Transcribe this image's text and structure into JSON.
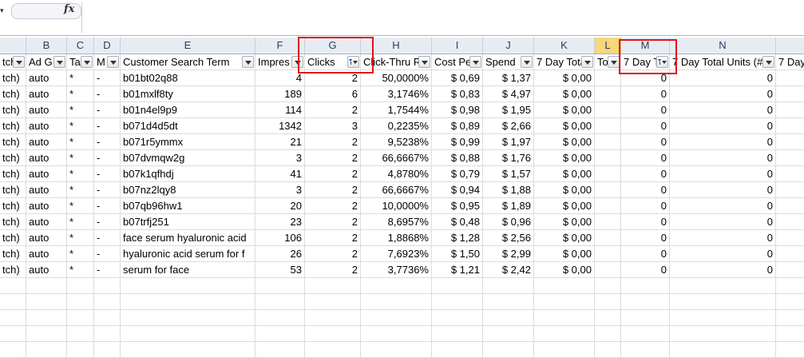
{
  "formula_bar": {
    "namebox_arrow_icon": "dropdown-arrow",
    "fx_label": "fx",
    "formula_value": ""
  },
  "column_headers": [
    "",
    "B",
    "C",
    "D",
    "E",
    "F",
    "G",
    "H",
    "I",
    "J",
    "K",
    "L",
    "M",
    "N",
    ""
  ],
  "active_column": "L",
  "header_row": [
    "tch)",
    "Ad G",
    "Ta",
    "M",
    "Customer Search Term",
    "Impres",
    "Clicks",
    "Click-Thru R",
    "Cost Pe",
    "Spend",
    "7 Day Tota",
    "To",
    "7 Day T",
    "7 Day Total Units (#",
    "7 Day"
  ],
  "filtered_columns": [
    "G",
    "M"
  ],
  "rows": [
    [
      "tch)",
      "auto",
      "*",
      "-",
      "b01bt02q88",
      "4",
      "2",
      "50,0000%",
      "$ 0,69",
      "$ 1,37",
      "$ 0,00",
      "",
      "0",
      "0",
      ""
    ],
    [
      "tch)",
      "auto",
      "*",
      "-",
      "b01mxlf8ty",
      "189",
      "6",
      "3,1746%",
      "$ 0,83",
      "$ 4,97",
      "$ 0,00",
      "",
      "0",
      "0",
      ""
    ],
    [
      "tch)",
      "auto",
      "*",
      "-",
      "b01n4el9p9",
      "114",
      "2",
      "1,7544%",
      "$ 0,98",
      "$ 1,95",
      "$ 0,00",
      "",
      "0",
      "0",
      ""
    ],
    [
      "tch)",
      "auto",
      "*",
      "-",
      "b071d4d5dt",
      "1342",
      "3",
      "0,2235%",
      "$ 0,89",
      "$ 2,66",
      "$ 0,00",
      "",
      "0",
      "0",
      ""
    ],
    [
      "tch)",
      "auto",
      "*",
      "-",
      "b071r5ymmx",
      "21",
      "2",
      "9,5238%",
      "$ 0,99",
      "$ 1,97",
      "$ 0,00",
      "",
      "0",
      "0",
      ""
    ],
    [
      "tch)",
      "auto",
      "*",
      "-",
      "b07dvmqw2g",
      "3",
      "2",
      "66,6667%",
      "$ 0,88",
      "$ 1,76",
      "$ 0,00",
      "",
      "0",
      "0",
      ""
    ],
    [
      "tch)",
      "auto",
      "*",
      "-",
      "b07k1qfhdj",
      "41",
      "2",
      "4,8780%",
      "$ 0,79",
      "$ 1,57",
      "$ 0,00",
      "",
      "0",
      "0",
      ""
    ],
    [
      "tch)",
      "auto",
      "*",
      "-",
      "b07nz2lqy8",
      "3",
      "2",
      "66,6667%",
      "$ 0,94",
      "$ 1,88",
      "$ 0,00",
      "",
      "0",
      "0",
      ""
    ],
    [
      "tch)",
      "auto",
      "*",
      "-",
      "b07qb96hw1",
      "20",
      "2",
      "10,0000%",
      "$ 0,95",
      "$ 1,89",
      "$ 0,00",
      "",
      "0",
      "0",
      ""
    ],
    [
      "tch)",
      "auto",
      "*",
      "-",
      "b07trfj251",
      "23",
      "2",
      "8,6957%",
      "$ 0,48",
      "$ 0,96",
      "$ 0,00",
      "",
      "0",
      "0",
      ""
    ],
    [
      "tch)",
      "auto",
      "*",
      "-",
      "face serum hyaluronic acid",
      "106",
      "2",
      "1,8868%",
      "$ 1,28",
      "$ 2,56",
      "$ 0,00",
      "",
      "0",
      "0",
      ""
    ],
    [
      "tch)",
      "auto",
      "*",
      "-",
      "hyaluronic acid serum for f",
      "26",
      "2",
      "7,6923%",
      "$ 1,50",
      "$ 2,99",
      "$ 0,00",
      "",
      "0",
      "0",
      ""
    ],
    [
      "tch)",
      "auto",
      "*",
      "-",
      "serum for face",
      "53",
      "2",
      "3,7736%",
      "$ 1,21",
      "$ 2,42",
      "$ 0,00",
      "",
      "0",
      "0",
      ""
    ]
  ],
  "colors": {
    "highlight_box": "#e3121b",
    "active_column_header": "#f7d67c",
    "header_background": "#e7ecf3"
  }
}
